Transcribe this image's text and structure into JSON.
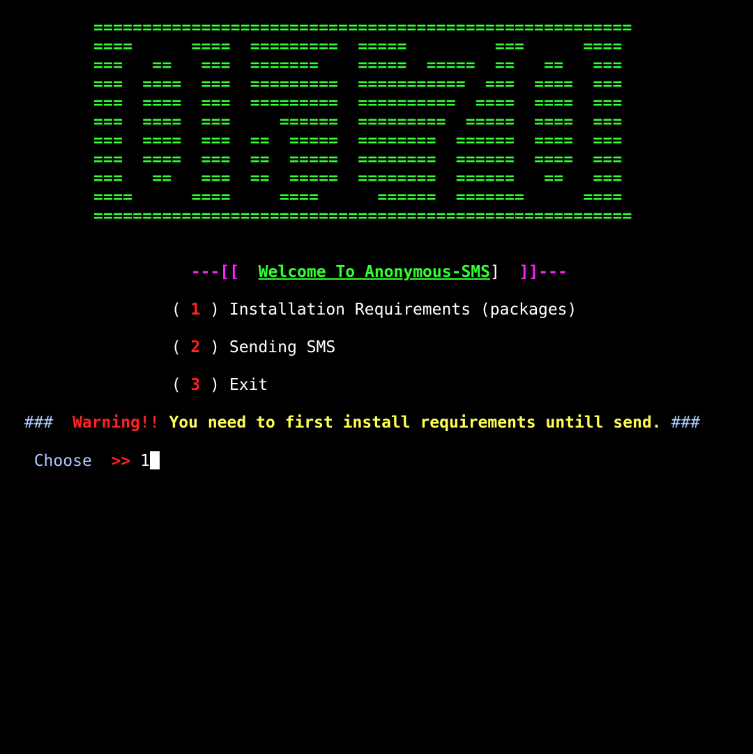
{
  "banner": {
    "lines": [
      "=======================================================",
      "====      ====  =========  =====         ===      ====",
      "===   ==   ===  =======    =====  =====  ==   ==   ===",
      "===  ====  ===  =========  ===========  ===  ====  ===",
      "===  ====  ===  =========  ==========  ====  ====  ===",
      "===  ====  ===     ======  =========  =====  ====  ===",
      "===  ====  ===  ==  =====  ========  ======  ====  ===",
      "===  ====  ===  ==  =====  ========  ======  ====  ===",
      "===   ==   ===  ==  =====  ========  ======   ==   ===",
      "====      ====     ====      ======  =======      ====",
      "======================================================="
    ],
    "color": "#33ff33"
  },
  "welcome": {
    "left_deco": "---[[",
    "title": "Welcome To Anonymous-SMS",
    "bracket": "]",
    "right_deco": "]]---"
  },
  "menu": {
    "items": [
      {
        "open": "(",
        "number": "1",
        "close": ")",
        "label": "Installation Requirements (packages)"
      },
      {
        "open": "(",
        "number": "2",
        "close": ")",
        "label": "Sending SMS"
      },
      {
        "open": "(",
        "number": "3",
        "close": ")",
        "label": "Exit"
      }
    ]
  },
  "warning": {
    "prefix": "###",
    "label": "Warning!!",
    "message": "You need to first install requirements untill send.",
    "suffix": "###"
  },
  "prompt": {
    "label": "Choose",
    "arrow": ">>",
    "input_value": "1"
  },
  "colors": {
    "background": "#000000",
    "green": "#33ff33",
    "magenta": "#ff22ff",
    "red": "#ff2222",
    "yellow": "#ffff55",
    "blue": "#aaccff",
    "white": "#ffffff"
  }
}
